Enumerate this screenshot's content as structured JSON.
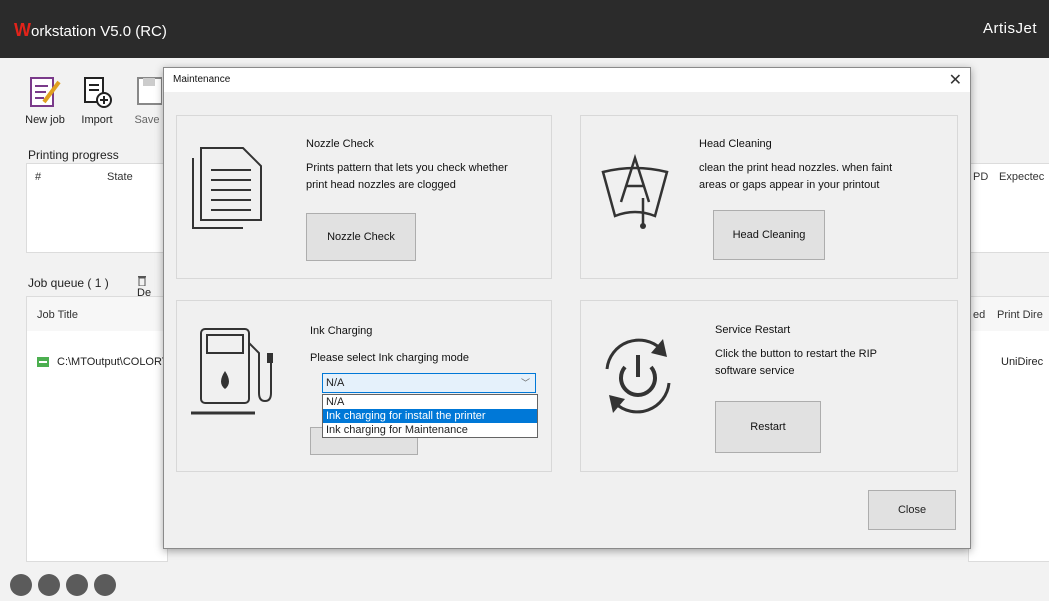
{
  "app": {
    "title_initial": "W",
    "title_rest": "orkstation V5.0 (RC)",
    "brand": "ArtisJet"
  },
  "toolbar": {
    "new_job": "New job",
    "import": "Import",
    "save": "Save"
  },
  "printing": {
    "label": "Printing progress",
    "columns": [
      "#",
      "State"
    ],
    "right_columns": [
      "PD",
      "Expectec"
    ]
  },
  "queue": {
    "label": "Job queue ( 1 )",
    "delete_label": "De",
    "col_title": "Job Title",
    "right_columns": [
      "ed",
      "Print Dire"
    ],
    "rows": [
      {
        "path": "C:\\MTOutput\\COLORTE",
        "direction": "UniDirec"
      }
    ]
  },
  "dialog": {
    "title": "Maintenance",
    "close_label": "Close",
    "nozzle": {
      "title": "Nozzle Check",
      "desc_line1": "Prints pattern that lets you check whether",
      "desc_line2": "print head nozzles are clogged",
      "button": "Nozzle Check"
    },
    "head": {
      "title": "Head Cleaning",
      "desc_line1": "clean the print head nozzles. when faint",
      "desc_line2": "areas or gaps appear in your printout",
      "button": "Head Cleaning"
    },
    "ink": {
      "title": "Ink Charging",
      "desc": "Please select Ink charging mode",
      "selected": "N/A",
      "options": [
        "N/A",
        "Ink charging for install the printer",
        "Ink charging for Maintenance"
      ]
    },
    "service": {
      "title": "Service Restart",
      "desc_line1": "Click the button to restart the RIP",
      "desc_line2": "software service",
      "button": "Restart"
    }
  }
}
